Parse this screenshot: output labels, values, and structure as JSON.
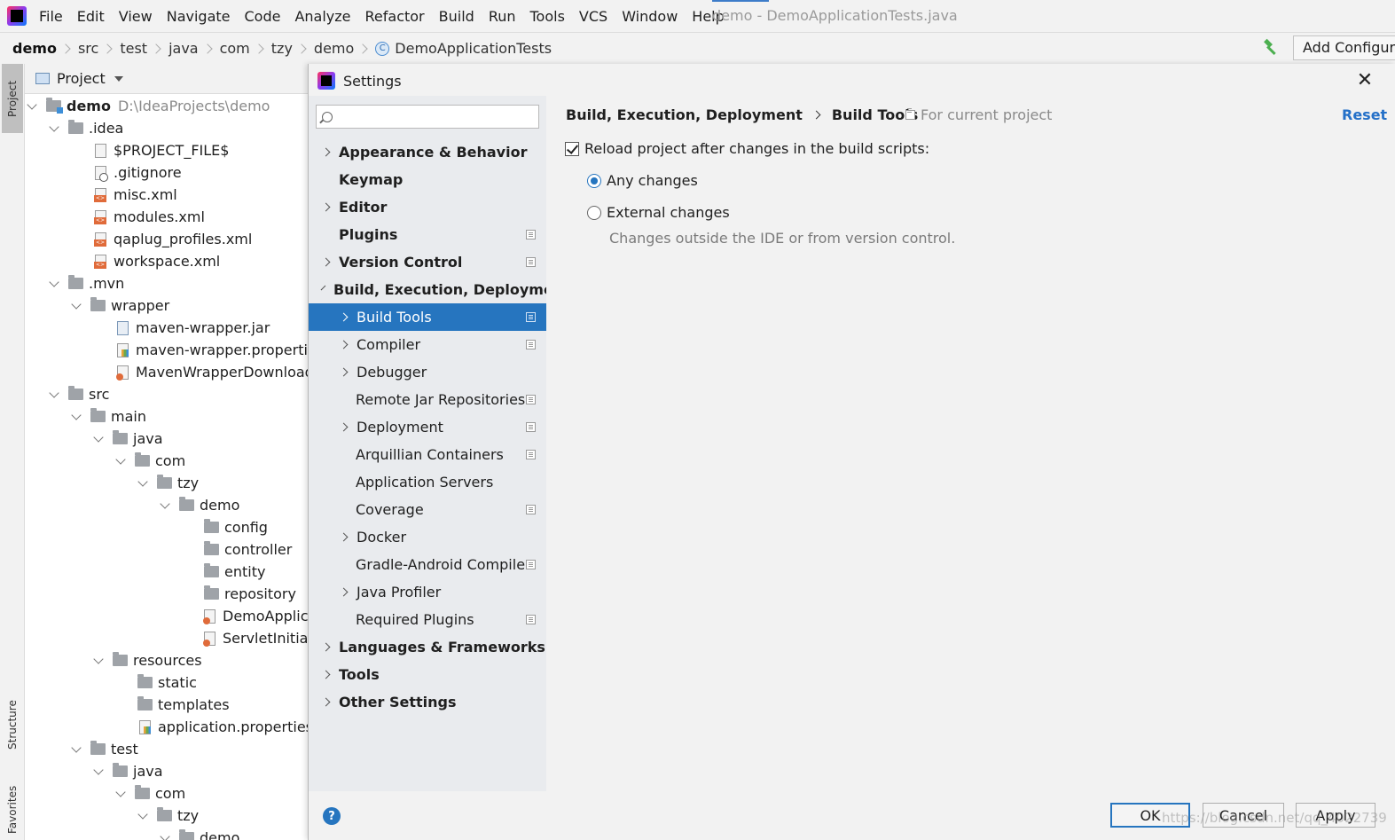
{
  "menubar": {
    "items": [
      "File",
      "Edit",
      "View",
      "Navigate",
      "Code",
      "Analyze",
      "Refactor",
      "Build",
      "Run",
      "Tools",
      "VCS",
      "Window",
      "Help"
    ],
    "window_title": "demo - DemoApplicationTests.java"
  },
  "navbar": {
    "crumbs": [
      "demo",
      "src",
      "test",
      "java",
      "com",
      "tzy",
      "demo"
    ],
    "current_class": "DemoApplicationTests",
    "class_icon_letter": "C",
    "add_configuration": "Add Configura"
  },
  "stripe": {
    "project": "Project",
    "structure": "Structure",
    "favorites": "Favorites"
  },
  "project_panel": {
    "header": "Project",
    "root_name": "demo",
    "root_path": "D:\\IdeaProjects\\demo",
    "rows": [
      {
        "label": ".idea"
      },
      {
        "label": "$PROJECT_FILE$"
      },
      {
        "label": ".gitignore"
      },
      {
        "label": "misc.xml"
      },
      {
        "label": "modules.xml"
      },
      {
        "label": "qaplug_profiles.xml"
      },
      {
        "label": "workspace.xml"
      },
      {
        "label": ".mvn"
      },
      {
        "label": "wrapper"
      },
      {
        "label": "maven-wrapper.jar"
      },
      {
        "label": "maven-wrapper.properties"
      },
      {
        "label": "MavenWrapperDownloader"
      },
      {
        "label": "src"
      },
      {
        "label": "main"
      },
      {
        "label": "java"
      },
      {
        "label": "com"
      },
      {
        "label": "tzy"
      },
      {
        "label": "demo"
      },
      {
        "label": "config"
      },
      {
        "label": "controller"
      },
      {
        "label": "entity"
      },
      {
        "label": "repository"
      },
      {
        "label": "DemoApplica"
      },
      {
        "label": "ServletInitializ"
      },
      {
        "label": "resources"
      },
      {
        "label": "static"
      },
      {
        "label": "templates"
      },
      {
        "label": "application.properties"
      },
      {
        "label": "test"
      },
      {
        "label": "java"
      },
      {
        "label": "com"
      },
      {
        "label": "tzy"
      },
      {
        "label": "demo"
      }
    ]
  },
  "dialog": {
    "title": "Settings",
    "search": {
      "value": "",
      "placeholder": ""
    },
    "nav": [
      {
        "label": "Appearance & Behavior"
      },
      {
        "label": "Keymap"
      },
      {
        "label": "Editor"
      },
      {
        "label": "Plugins"
      },
      {
        "label": "Version Control"
      },
      {
        "label": "Build, Execution, Deployment"
      },
      {
        "label": "Build Tools"
      },
      {
        "label": "Compiler"
      },
      {
        "label": "Debugger"
      },
      {
        "label": "Remote Jar Repositories"
      },
      {
        "label": "Deployment"
      },
      {
        "label": "Arquillian Containers"
      },
      {
        "label": "Application Servers"
      },
      {
        "label": "Coverage"
      },
      {
        "label": "Docker"
      },
      {
        "label": "Gradle-Android Compiler"
      },
      {
        "label": "Java Profiler"
      },
      {
        "label": "Required Plugins"
      },
      {
        "label": "Languages & Frameworks"
      },
      {
        "label": "Tools"
      },
      {
        "label": "Other Settings"
      }
    ],
    "content": {
      "breadcrumb_parent": "Build, Execution, Deployment",
      "breadcrumb_current": "Build Tools",
      "for_current_project": "For current project",
      "reset": "Reset",
      "reload_label": "Reload project after changes in the build scripts:",
      "reload_checked": true,
      "option_any": "Any changes",
      "option_external": "External changes",
      "selected_option": "Any changes",
      "external_hint": "Changes outside the IDE or from version control."
    },
    "buttons": {
      "help": "?",
      "ok": "OK",
      "cancel": "Cancel",
      "apply": "Apply"
    }
  },
  "watermark": "https://blog.csdn.net/qq_4022739"
}
